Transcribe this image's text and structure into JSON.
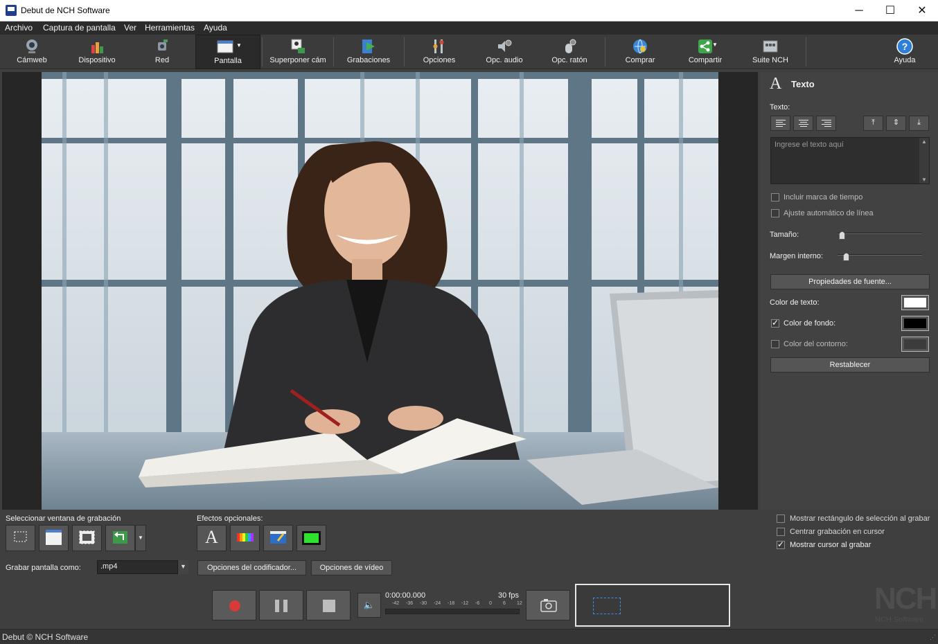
{
  "window": {
    "title": "Debut de NCH Software",
    "minimize_glyph": "─",
    "maximize_glyph": "☐",
    "close_glyph": "✕"
  },
  "menu": [
    "Archivo",
    "Captura de pantalla",
    "Ver",
    "Herramientas",
    "Ayuda"
  ],
  "toolbar": {
    "camweb": "Cámweb",
    "dispositivo": "Dispositivo",
    "red": "Red",
    "pantalla": "Pantalla",
    "superponer": "Superponer cám",
    "grabaciones": "Grabaciones",
    "opciones": "Opciones",
    "opc_audio": "Opc. audio",
    "opc_raton": "Opc. ratón",
    "comprar": "Comprar",
    "compartir": "Compartir",
    "suite": "Suite NCH",
    "ayuda": "Ayuda"
  },
  "text_panel": {
    "title": "Texto",
    "text_label": "Texto:",
    "placeholder": "Ingrese el texto aquí",
    "include_timestamp": "Incluir marca de tiempo",
    "include_timestamp_checked": false,
    "auto_wrap": "Ajuste automático de línea",
    "auto_wrap_checked": false,
    "size_label": "Tamaño:",
    "size_value": 0.05,
    "padding_label": "Margen interno:",
    "padding_value": 0.1,
    "font_props": "Propiedades de fuente...",
    "text_color_label": "Color de texto:",
    "text_color": "#ffffff",
    "bg_color_label": "Color de fondo:",
    "bg_color_checked": true,
    "bg_color": "#000000",
    "outline_color_label": "Color del contorno:",
    "outline_color_checked": false,
    "outline_color": "#3c3c3c",
    "reset": "Restablecer"
  },
  "bottom": {
    "select_window_label": "Seleccionar ventana de grabación",
    "effects_label": "Efectos opcionales:",
    "record_as_label": "Grabar pantalla como:",
    "format": ".mp4",
    "encoder_options": "Opciones del codificador...",
    "video_options": "Opciones de vídeo",
    "time": "0:00:00.000",
    "fps": "30 fps",
    "meter_ticks": [
      "-42",
      "-36",
      "-30",
      "-24",
      "-18",
      "-12",
      "-6",
      "0",
      "6",
      "12"
    ],
    "show_selection_rect": "Mostrar rectángulo de selección al grabar",
    "show_selection_rect_checked": false,
    "center_on_cursor": "Centrar grabación en cursor",
    "center_on_cursor_checked": false,
    "show_cursor": "Mostrar cursor al grabar",
    "show_cursor_checked": true,
    "logo_text": "NCH",
    "logo_sub": "NCH Software"
  },
  "status": "Debut © NCH Software",
  "colors": {
    "accent": "#2f7fd8",
    "record": "#d83a3a"
  }
}
